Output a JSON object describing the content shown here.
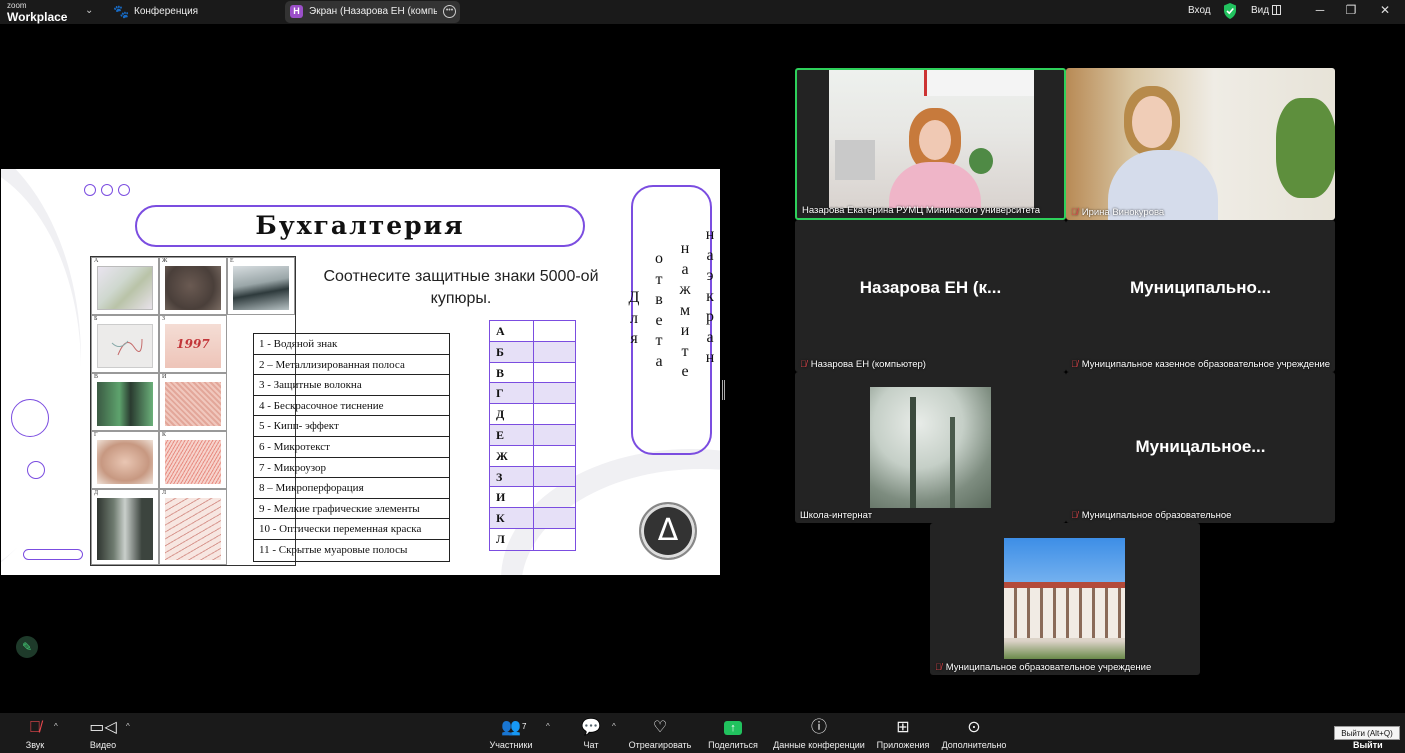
{
  "titlebar": {
    "logo_small": "zoom",
    "logo_big": "Workplace",
    "meeting": "Конференция",
    "share_tab_initial": "Н",
    "share_tab_title": "Экран (Назарова ЕН (компьютер",
    "sign_in": "Вход",
    "view": "Вид",
    "minimize": "─",
    "restore": "❐",
    "close": "✕"
  },
  "slide": {
    "title": "Бухгалтерия",
    "subtitle": "Соотнесите защитные знаки 5000-ой купюры.",
    "images": [
      {
        "letter": "А"
      },
      {
        "letter": "Ж"
      },
      {
        "letter": "Е"
      },
      {
        "letter": "Б"
      },
      {
        "letter": "З"
      },
      {
        "letter": "В"
      },
      {
        "letter": "И"
      },
      {
        "letter": "Г"
      },
      {
        "letter": "К"
      },
      {
        "letter": "Д"
      },
      {
        "letter": "Л"
      }
    ],
    "image_text_1997": "1997",
    "features": [
      "1 -  Водяной знак",
      "2 – Металлизированная полоса",
      "3 - Защитные волокна",
      "4 - Бескрасочное тиснение",
      "5 - Кипп- эффект",
      "6 -  Микротекст",
      "7 -  Микроузор",
      "8 – Микроперфорация",
      "9 - Мелкие графические элементы",
      "10 - Оптически  переменная краска",
      "11 - Скрытые муаровые полосы"
    ],
    "answer_letters": [
      "А",
      "Б",
      "В",
      "Г",
      "Д",
      "Е",
      "Ж",
      "З",
      "И",
      "К",
      "Л"
    ],
    "vertical_words": [
      "Для",
      "ответа",
      "нажмите",
      "на экран"
    ],
    "delta_symbol": "Δ"
  },
  "participants": {
    "p1_label": "Назарова Екатерина РУМЦ Мининского университета",
    "p2_label": "Ирина Винокурова",
    "p3_name": "Назарова  ЕН  (к...",
    "p3_label": "Назарова ЕН (компьютер)",
    "p4_name": "Муниципально...",
    "p4_label": "Муниципальное казенное образовательное учреждение",
    "p5_label": "Школа-интернат",
    "p6_name": "Муницальное...",
    "p6_label": "Муниципальное образовательное",
    "p7_label": "Муниципальное образовательное учреждение"
  },
  "toolbar": {
    "audio": "Звук",
    "video": "Видео",
    "participants": "Участники",
    "participants_count": "7",
    "chat": "Чат",
    "react": "Отреагировать",
    "share": "Поделиться",
    "meeting_info": "Данные конференции",
    "apps": "Приложения",
    "more": "Дополнительно",
    "leave": "Выйти",
    "leave_tooltip": "Выйти (Alt+Q)"
  },
  "colors": {
    "accent_purple": "#7b4de0",
    "active_speaker": "#2ed05b",
    "share_green": "#21c25e",
    "mute_red": "#e8484d"
  }
}
